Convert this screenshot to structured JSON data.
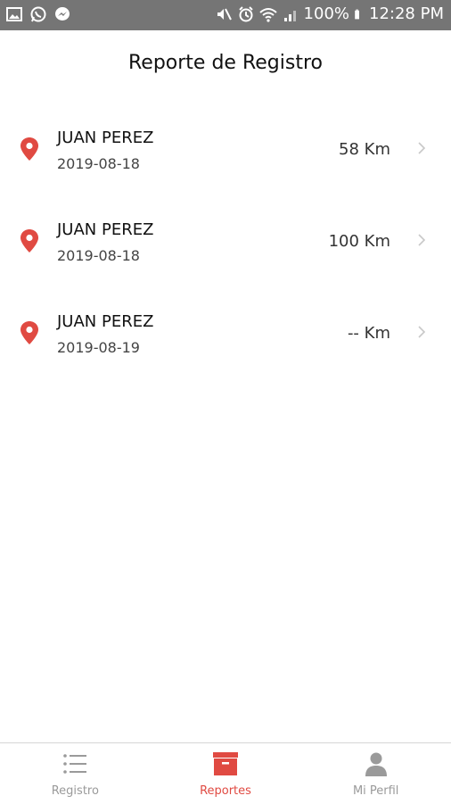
{
  "status_bar": {
    "left_icons": [
      "gallery-icon",
      "whatsapp-icon",
      "messenger-icon"
    ],
    "right_icons": [
      "mute-icon",
      "alarm-icon",
      "wifi-icon",
      "signal-icon",
      "battery-icon"
    ],
    "battery": "100%",
    "time": "12:28 PM"
  },
  "header": {
    "title": "Reporte de Registro"
  },
  "reports": [
    {
      "name": "JUAN PEREZ",
      "date": "2019-08-18",
      "distance": "58 Km"
    },
    {
      "name": "JUAN PEREZ",
      "date": "2019-08-18",
      "distance": "100 Km"
    },
    {
      "name": "JUAN PEREZ",
      "date": "2019-08-19",
      "distance": "-- Km"
    }
  ],
  "nav": {
    "items": [
      {
        "label": "Registro",
        "icon": "list-icon"
      },
      {
        "label": "Reportes",
        "icon": "archive-box-icon"
      },
      {
        "label": "Mi Perfil",
        "icon": "user-icon"
      }
    ],
    "active": "Reportes"
  },
  "colors": {
    "accent": "#e04a42",
    "status_bar": "#757575",
    "inactive": "#9a9a9a"
  }
}
